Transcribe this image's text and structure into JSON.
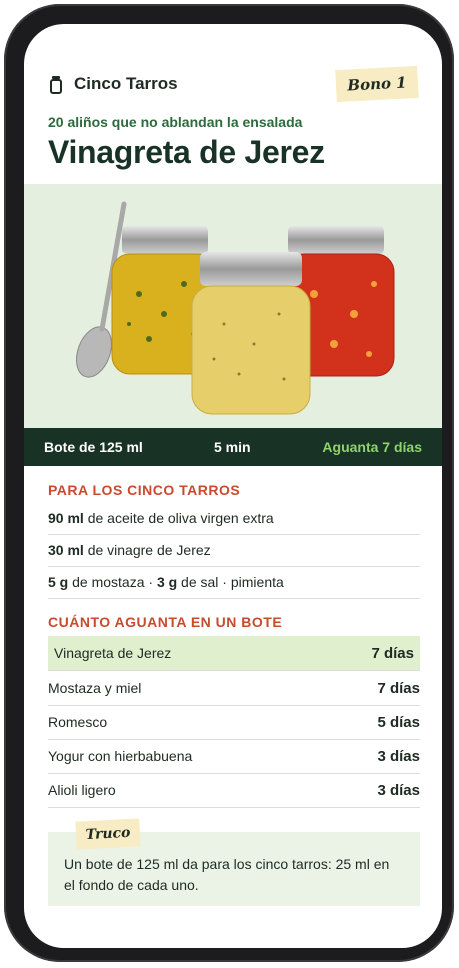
{
  "header": {
    "brand": "Cinco Tarros",
    "badge": "Bono 1",
    "brand_icon": "jar-icon"
  },
  "recipe": {
    "subtitle": "20 aliños que no ablandan la ensalada",
    "title": "Vinagreta de Jerez",
    "hero_image": "jars-with-spoon"
  },
  "info": {
    "size": "Bote de 125 ml",
    "time": "5 min",
    "keeps": "Aguanta 7 días"
  },
  "ingredients": {
    "heading": "PARA LOS CINCO TARROS",
    "items": [
      {
        "q1": "90 ml",
        "t1": " de aceite de oliva virgen extra",
        "q2": "",
        "t2": ""
      },
      {
        "q1": "30 ml",
        "t1": " de vinagre de Jerez",
        "q2": "",
        "t2": ""
      },
      {
        "q1": "5 g",
        "t1": " de mostaza · ",
        "q2": "3 g",
        "t2": " de sal · pimienta"
      }
    ]
  },
  "shelf": {
    "heading": "CUÁNTO AGUANTA EN UN BOTE",
    "rows": [
      {
        "name": "Vinagreta de Jerez",
        "days": "7 días"
      },
      {
        "name": "Mostaza y miel",
        "days": "7 días"
      },
      {
        "name": "Romesco",
        "days": "5 días"
      },
      {
        "name": "Yogur con hierbabuena",
        "days": "3 días"
      },
      {
        "name": "Alioli ligero",
        "days": "3 días"
      }
    ]
  },
  "tip": {
    "label": "Truco",
    "text": "Un bote de 125 ml da para los cinco tarros: 25 ml en el fondo de cada uno."
  },
  "colors": {
    "dark_green": "#183326",
    "accent_red": "#c94a2e",
    "accent_lime": "#8fd36a",
    "highlight": "#e0f0cf"
  }
}
